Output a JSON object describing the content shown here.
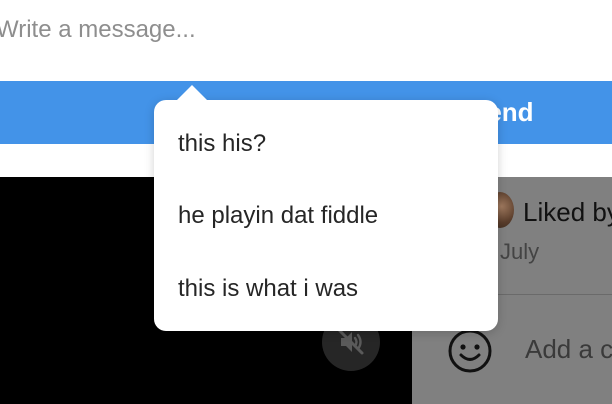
{
  "composer": {
    "placeholder": "Write a message...",
    "send_label": "Send"
  },
  "suggestions": [
    "this his?",
    "he playin dat fiddle",
    "this is what i was"
  ],
  "side_panel": {
    "liked_by": "Liked by",
    "sub_text": "July",
    "comment_placeholder": "Add a comment..."
  },
  "icons": {
    "mute": "speaker-muted-icon",
    "emoji": "smiley-face-icon"
  },
  "colors": {
    "send_bar": "#4393e8",
    "video_background": "#000000",
    "overlay_panel": "#808080"
  }
}
